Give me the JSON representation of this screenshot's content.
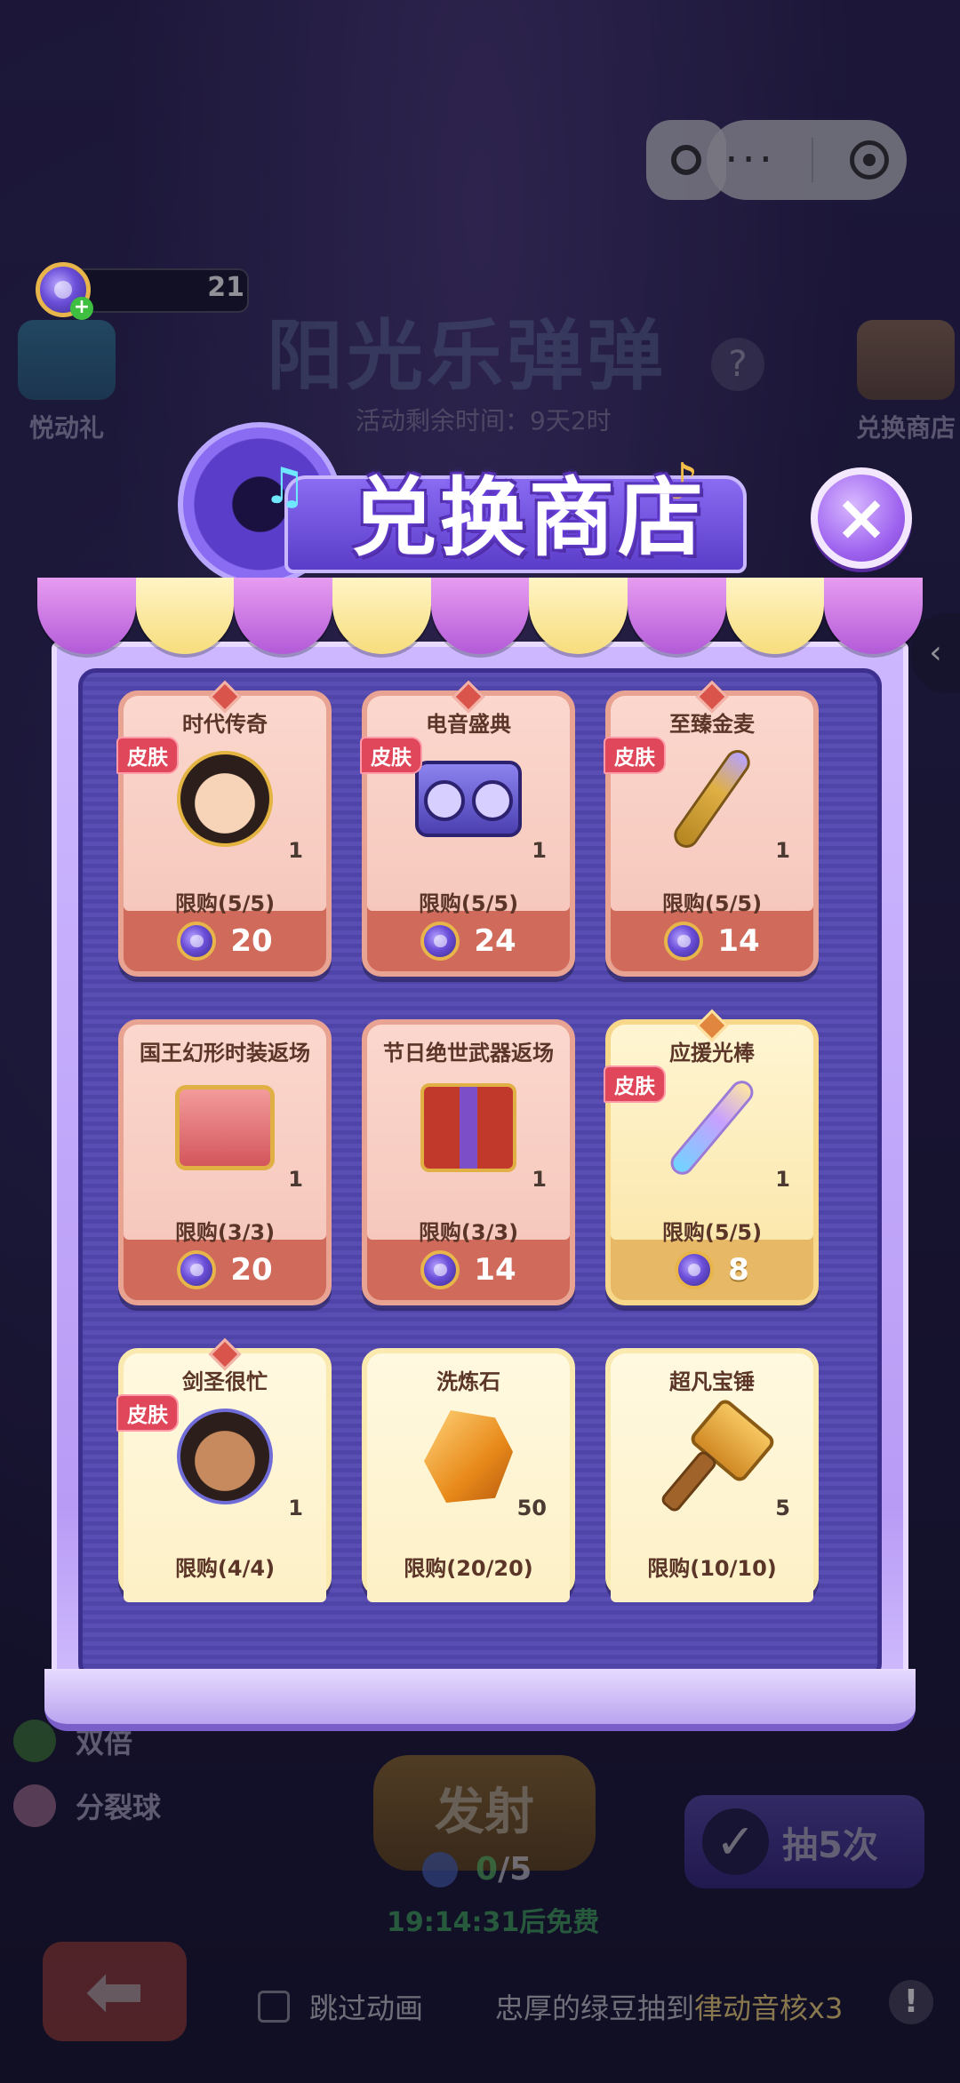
{
  "background": {
    "event_title": "阳光乐弹弹",
    "event_timer": "活动剩余时间：9天2时",
    "currency_value": "21",
    "left_button": "悦动礼",
    "right_button": "兑换商店",
    "capsule_dots": "···",
    "skills": [
      "双倍",
      "分裂球"
    ],
    "fire_label": "发射",
    "fire_count_current": "0",
    "fire_count_total": "/5",
    "free_timer": "19:14:31后免费",
    "draw5_label": "抽5次",
    "skip_label": "跳过动画",
    "ticker": {
      "prefix": "忠厚的绿豆抽到",
      "item": "律动音核x3"
    }
  },
  "shop": {
    "title": "兑换商店",
    "close_icon": "×",
    "items": [
      {
        "name": "时代传奇",
        "tag": "皮肤",
        "qty": "1",
        "limit": "限购(5/5)",
        "price": "20",
        "style": "red",
        "icon": "avatar-crown-icon"
      },
      {
        "name": "电音盛典",
        "tag": "皮肤",
        "qty": "1",
        "limit": "限购(5/5)",
        "price": "24",
        "style": "red",
        "icon": "speaker-icon"
      },
      {
        "name": "至臻金麦",
        "tag": "皮肤",
        "qty": "1",
        "limit": "限购(5/5)",
        "price": "14",
        "style": "red",
        "icon": "microphone-icon"
      },
      {
        "name": "国王幻形时装返场",
        "tag": "",
        "qty": "1",
        "limit": "限购(3/3)",
        "price": "20",
        "style": "red",
        "icon": "chest-icon"
      },
      {
        "name": "节日绝世武器返场",
        "tag": "",
        "qty": "1",
        "limit": "限购(3/3)",
        "price": "14",
        "style": "red",
        "icon": "gift-box-icon"
      },
      {
        "name": "应援光棒",
        "tag": "皮肤",
        "qty": "1",
        "limit": "限购(5/5)",
        "price": "8",
        "style": "gold",
        "icon": "glow-stick-icon"
      },
      {
        "name": "剑圣很忙",
        "tag": "皮肤",
        "qty": "1",
        "limit": "限购(4/4)",
        "price": "",
        "style": "cream",
        "icon": "swordsman-icon"
      },
      {
        "name": "洗炼石",
        "tag": "",
        "qty": "50",
        "limit": "限购(20/20)",
        "price": "",
        "style": "cream",
        "icon": "stone-icon"
      },
      {
        "name": "超凡宝锤",
        "tag": "",
        "qty": "5",
        "limit": "限购(10/10)",
        "price": "",
        "style": "cream",
        "icon": "hammer-icon"
      }
    ]
  },
  "colors": {
    "accent_purple": "#8a6cf2",
    "card_red": "#d06a5a",
    "card_gold": "#e7b865",
    "tag_red": "#e0475a"
  }
}
